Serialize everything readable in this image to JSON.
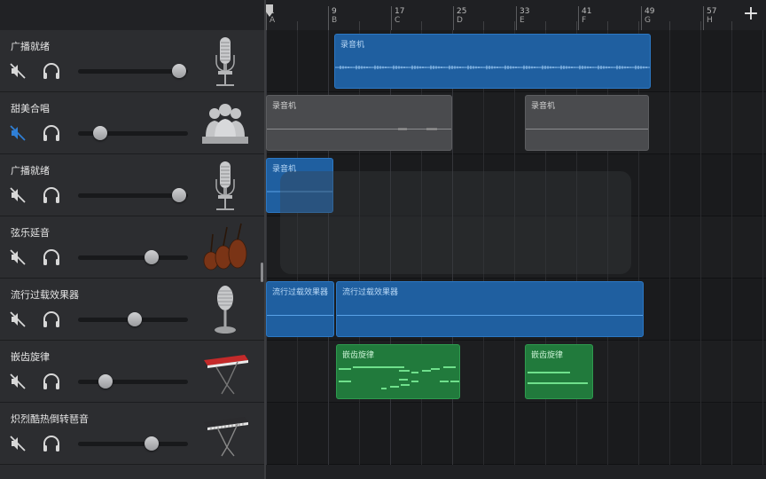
{
  "ruler": {
    "bars": [
      {
        "num": "1",
        "letter": "A"
      },
      {
        "num": "9",
        "letter": "B"
      },
      {
        "num": "17",
        "letter": "C"
      },
      {
        "num": "25",
        "letter": "D"
      },
      {
        "num": "33",
        "letter": "E"
      },
      {
        "num": "41",
        "letter": "F"
      },
      {
        "num": "49",
        "letter": "G"
      },
      {
        "num": "57",
        "letter": "H"
      }
    ],
    "add_label": "+"
  },
  "tracks": [
    {
      "name": "广播就绪",
      "muted": false,
      "volume": 0.92,
      "instrument": "condenser-mic-icon"
    },
    {
      "name": "甜美合唱",
      "muted": true,
      "volume": 0.2,
      "instrument": "choir-icon"
    },
    {
      "name": "广播就绪",
      "muted": false,
      "volume": 0.92,
      "instrument": "condenser-mic-icon"
    },
    {
      "name": "弦乐延音",
      "muted": false,
      "volume": 0.67,
      "instrument": "strings-icon"
    },
    {
      "name": "流行过载效果器",
      "muted": false,
      "volume": 0.52,
      "instrument": "vintage-mic-icon"
    },
    {
      "name": "嵌齿旋律",
      "muted": false,
      "volume": 0.25,
      "instrument": "red-synth-keyboard-icon"
    },
    {
      "name": "炽烈酷热倒转琶音",
      "muted": false,
      "volume": 0.67,
      "instrument": "synth-keyboard-icon"
    }
  ],
  "regions": [
    {
      "label": "录音机",
      "color": "blue"
    },
    {
      "label": "录音机",
      "color": "gray"
    },
    {
      "label": "录音机",
      "color": "gray"
    },
    {
      "label": "录音机",
      "color": "blue"
    },
    {
      "label": "流行过载效果器",
      "color": "blue"
    },
    {
      "label": "流行过载效果器",
      "color": "blue"
    },
    {
      "label": "嵌齿旋律",
      "color": "green"
    },
    {
      "label": "嵌齿旋律",
      "color": "green"
    }
  ],
  "colors": {
    "audio_region": "#1f5fa0",
    "muted_region": "#4a4b4e",
    "midi_region": "#217a3c",
    "mute_active": "#2f7fd6"
  }
}
